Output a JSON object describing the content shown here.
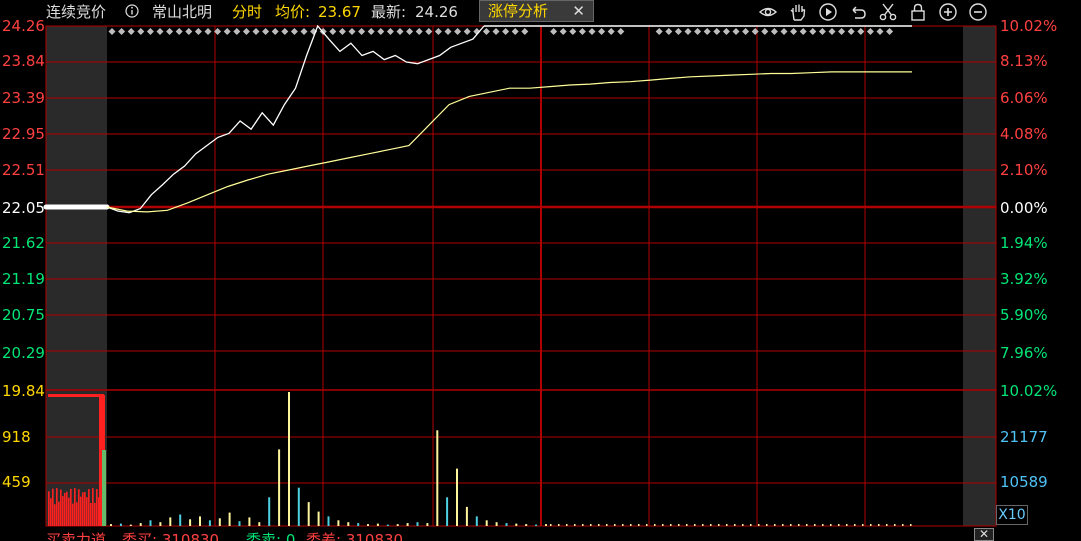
{
  "header": {
    "mode_label": "连续竞价",
    "info_icon": "info-circle-icon",
    "stock_name": "常山北明",
    "view_label": "分时",
    "avg_label": "均价:",
    "avg_value": "23.67",
    "latest_label": "最新:",
    "latest_value": "24.26",
    "tab_label": "涨停分析",
    "tab_close": "✕",
    "toolbar_icons": [
      "eye-icon",
      "hand-icon",
      "play-icon",
      "undo-icon",
      "scissors-icon",
      "lock-icon",
      "zoom-in-icon",
      "zoom-out-icon"
    ]
  },
  "price_axis": {
    "left_labels": [
      "24.26",
      "23.84",
      "23.39",
      "22.95",
      "22.51",
      "22.05",
      "21.62",
      "21.19",
      "20.75",
      "20.29"
    ],
    "right_labels": [
      "10.02%",
      "8.13%",
      "6.06%",
      "4.08%",
      "2.10%",
      "0.00%",
      "1.94%",
      "3.92%",
      "5.90%",
      "7.96%"
    ]
  },
  "volume_axis": {
    "left_labels": [
      "19.84",
      "918",
      "459"
    ],
    "right_labels": [
      "10.02%",
      "21177",
      "10589"
    ],
    "scale_label": "X10"
  },
  "bottom_bar": {
    "text1": "买卖力道",
    "text2": "委买: 310830",
    "text3": "委卖: 0",
    "text4": "委差: 310830",
    "close": "✕"
  },
  "colors": {
    "grid": "#b00000",
    "axis_up": "#ff4040",
    "axis_down": "#00e676",
    "price_line": "#ffffff",
    "avg_line": "#ffff99",
    "avg_text": "#ffd700",
    "volume_text": "#4fc3f7",
    "vol_yellow": "#fff59d",
    "vol_cyan": "#4dd0e1",
    "auction_red": "#ff2020",
    "auction_green": "#66bb6a"
  },
  "chart_data": {
    "type": "line",
    "preclose": 22.05,
    "price_range": [
      19.84,
      24.26
    ],
    "series": [
      {
        "values": [
          22.05,
          22.0,
          21.98,
          22.03,
          22.2,
          22.32,
          22.45,
          22.55,
          22.7,
          22.8,
          22.9,
          22.95,
          23.1,
          23.0,
          23.2,
          23.05,
          23.3,
          23.5,
          23.9,
          24.26,
          24.1,
          23.95,
          24.05,
          23.9,
          23.95,
          23.85,
          23.9,
          23.82,
          23.8,
          23.85,
          23.9,
          24.0,
          24.05,
          24.1,
          24.26
        ]
      },
      {
        "values": [
          22.05,
          22.0,
          21.99,
          22.01,
          22.1,
          22.2,
          22.3,
          22.38,
          22.45,
          22.5,
          22.55,
          22.6,
          22.65,
          22.7,
          22.75,
          22.8,
          23.05,
          23.3,
          23.4,
          23.45,
          23.5,
          23.5,
          23.52,
          23.54,
          23.55,
          23.57,
          23.58,
          23.6,
          23.62,
          23.64,
          23.65,
          23.66,
          23.67,
          23.68,
          23.68,
          23.69,
          23.7,
          23.7,
          23.7,
          23.7,
          23.7
        ]
      }
    ],
    "volume": {
      "values": [
        20,
        25,
        15,
        30,
        60,
        40,
        90,
        120,
        70,
        100,
        60,
        80,
        140,
        50,
        90,
        40,
        300,
        800,
        1400,
        400,
        250,
        150,
        100,
        60,
        40,
        30,
        20,
        25,
        15,
        20,
        30,
        40,
        30,
        1000,
        300,
        600,
        200,
        100,
        60,
        40,
        30,
        25,
        20,
        15,
        20
      ]
    }
  }
}
